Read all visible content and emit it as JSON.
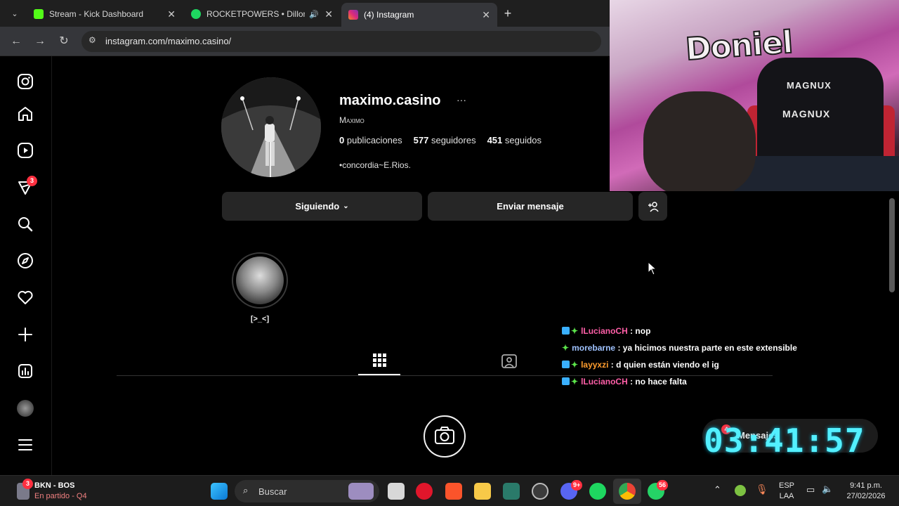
{
  "browser": {
    "tabs": [
      {
        "title": "Stream - Kick Dashboard",
        "close": "✕",
        "color": "#53fc18"
      },
      {
        "title": "ROCKETPOWERS • Dillom, S",
        "close": "✕",
        "color": "#1ed760"
      },
      {
        "title": "(4) Instagram",
        "close": "✕",
        "color": "#e1306c"
      }
    ],
    "new_tab": "+",
    "url": "instagram.com/maximo.casino/"
  },
  "sidenav": {
    "notifications_badge": "3"
  },
  "profile": {
    "username": "maximo.casino",
    "more": "···",
    "full_name": "Maximo",
    "stats": {
      "posts_count": "0",
      "posts_label": "publicaciones",
      "followers_count": "577",
      "followers_label": "seguidores",
      "following_count": "451",
      "following_label": "seguidos"
    },
    "bio": "•concordia~E.Rios.",
    "buttons": {
      "following": "Siguiendo",
      "message": "Enviar mensaje"
    },
    "highlight": {
      "label": "[>_<]"
    }
  },
  "chat": [
    {
      "user": "lLucianoCH",
      "user_color": "#ff5fa8",
      "message": ": nop",
      "badges": 2
    },
    {
      "user": "morebarne",
      "user_color": "#9fc2ff",
      "message": ": ya hicimos nuestra parte en este extensible",
      "badges": 1
    },
    {
      "user": "layyxzi",
      "user_color": "#ff9d2e",
      "message": ": d quien están viendo el ig",
      "badges": 2
    },
    {
      "user": "lLucianoCH",
      "user_color": "#ff5fa8",
      "message": ": no hace falta",
      "badges": 2
    }
  ],
  "overlay": {
    "timer": "03:41:57",
    "messages_label": "Mensajes",
    "messages_badge": "4"
  },
  "webcam": {
    "brand_top": "MAGNUX",
    "brand_mid": "MAGNUX",
    "wall_text": "Doniel"
  },
  "taskbar": {
    "game": {
      "title": "BKN - BOS",
      "status": "En partido - Q4",
      "badge": "3"
    },
    "search_label": "Buscar",
    "discord_badge": "9+",
    "whatsapp_badge": "56",
    "language": "ESP",
    "layout": "LAA",
    "time": "9:41 p.m.",
    "date": "27/02/2026"
  }
}
